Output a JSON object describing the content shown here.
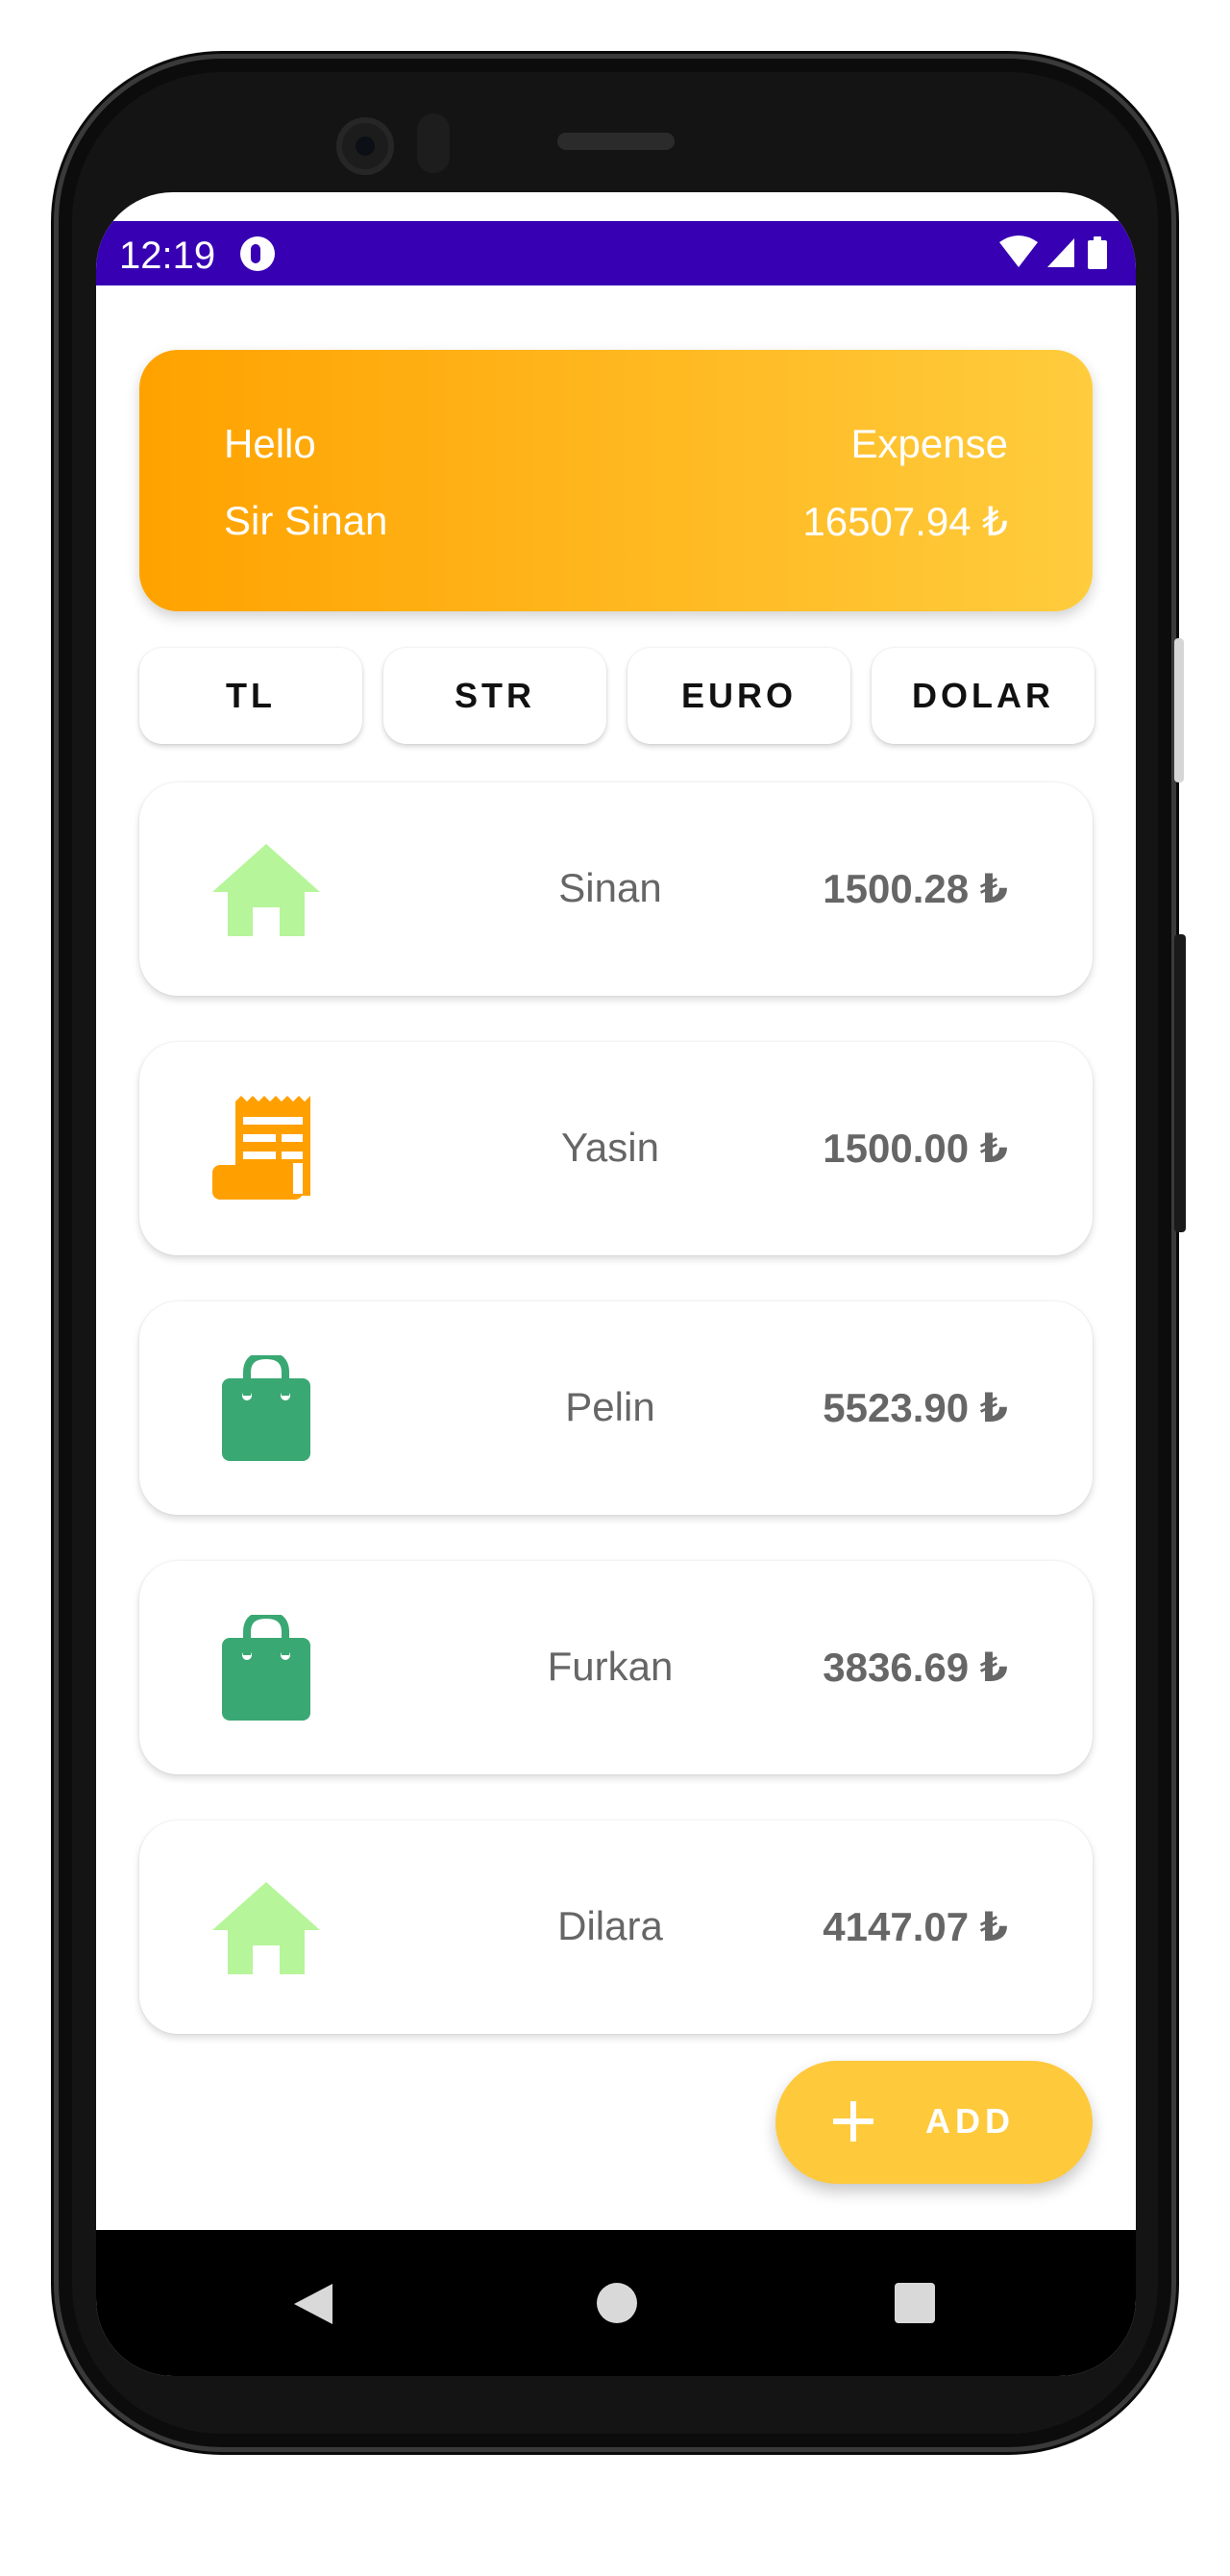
{
  "status_bar": {
    "time": "12:19"
  },
  "header": {
    "greeting": "Hello",
    "user_name": "Sir Sinan",
    "expense_label": "Expense",
    "expense_total": "16507.94 ₺"
  },
  "currencies": [
    "TL",
    "STR",
    "EURO",
    "DOLAR"
  ],
  "expenses": [
    {
      "icon": "home-icon",
      "name": "Sinan",
      "amount": "1500.28 ₺"
    },
    {
      "icon": "receipt-icon",
      "name": "Yasin",
      "amount": "1500.00 ₺"
    },
    {
      "icon": "shopping-bag-icon",
      "name": "Pelin",
      "amount": "5523.90 ₺"
    },
    {
      "icon": "shopping-bag-icon",
      "name": "Furkan",
      "amount": "3836.69 ₺"
    },
    {
      "icon": "home-icon",
      "name": "Dilara",
      "amount": "4147.07 ₺"
    }
  ],
  "fab": {
    "label": "ADD"
  },
  "colors": {
    "status_bar": "#3700b3",
    "header_gradient_start": "#ffa200",
    "header_gradient_end": "#ffcc3d",
    "fab": "#ffc93c",
    "home_icon": "#b6f59a",
    "receipt_icon": "#ffa000",
    "bag_icon": "#3aa873"
  }
}
